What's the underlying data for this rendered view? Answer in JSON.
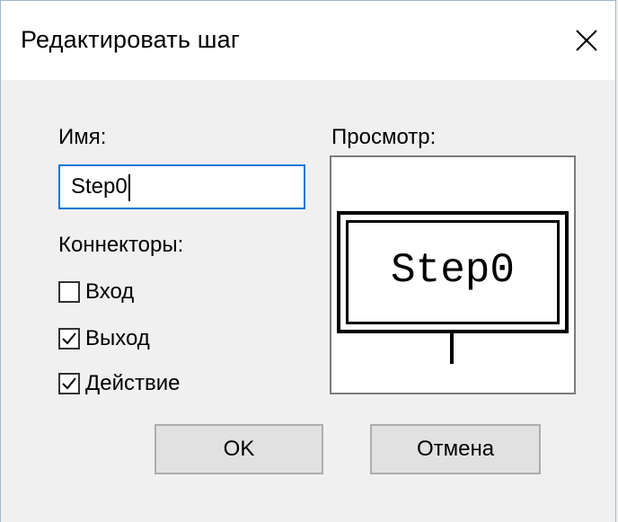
{
  "dialog": {
    "title": "Редактировать шаг",
    "close_glyph": "×"
  },
  "name_label": "Имя:",
  "name_input": {
    "value": "Step0"
  },
  "connectors": {
    "label": "Коннекторы:",
    "items": [
      {
        "label": "Вход",
        "checked": false
      },
      {
        "label": "Выход",
        "checked": true
      },
      {
        "label": "Действие",
        "checked": true
      }
    ]
  },
  "preview": {
    "label": "Просмотр:",
    "step_text": "Step0"
  },
  "buttons": {
    "ok": "OK",
    "cancel": "Отмена"
  },
  "colors": {
    "focus_border": "#0078d7",
    "button_face": "#e1e1e1",
    "dialog_background": "#f0f0f0"
  },
  "icons": {
    "close": "close-icon",
    "checkmark": "checkmark-icon"
  }
}
